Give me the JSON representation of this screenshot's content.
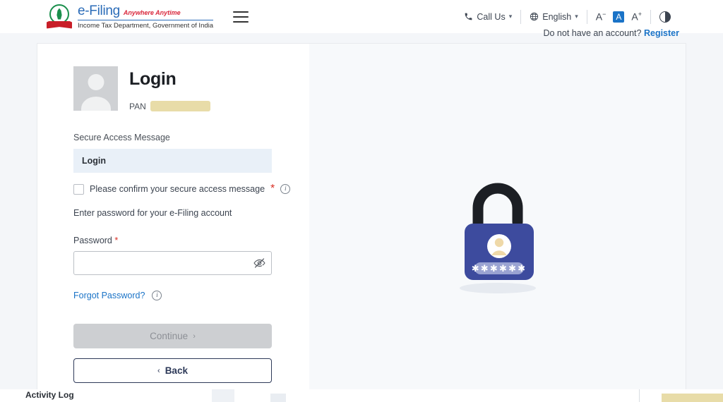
{
  "header": {
    "brand": {
      "name": "e-Filing",
      "tagline": "Anywhere Anytime",
      "department": "Income Tax Department, Government of India"
    },
    "menu_icon": "hamburger-menu-icon",
    "call_us": "Call Us",
    "language": "English",
    "font_decrease": "A",
    "font_normal": "A",
    "font_increase": "A",
    "contrast_icon": "contrast-toggle-icon",
    "account_prompt": "Do not have an account?",
    "register_link": "Register",
    "accent_blue": "#1a73c7"
  },
  "login": {
    "title": "Login",
    "pan_label": "PAN",
    "pan_value": "",
    "secure_access_label": "Secure Access Message",
    "secure_access_value": "Login",
    "confirm_checkbox_label": "Please confirm your secure access message",
    "confirm_required_mark": "*",
    "confirm_info_icon": "info-icon",
    "password_hint": "Enter password for your e-Filing account",
    "password_label": "Password",
    "password_required_mark": "*",
    "password_value": "",
    "password_placeholder": "",
    "password_toggle_icon": "eye-slash-icon",
    "forgot_password": "Forgot Password?",
    "forgot_info_icon": "info-icon",
    "continue_label": "Continue",
    "continue_arrow": "›",
    "continue_disabled": true,
    "back_label": "Back",
    "back_arrow": "‹",
    "secure_box_bg": "#e9f0f8",
    "disabled_btn_bg": "#cdcfd2",
    "back_border": "#2e3a59"
  },
  "illustration": {
    "name": "padlock-password-illustration",
    "body_color": "#3d4b9e",
    "shackle_color": "#1c1f24",
    "mask_char": "∗",
    "mask_count": 6
  },
  "bottom": {
    "activity_log": "Activity Log",
    "redacted": ""
  }
}
